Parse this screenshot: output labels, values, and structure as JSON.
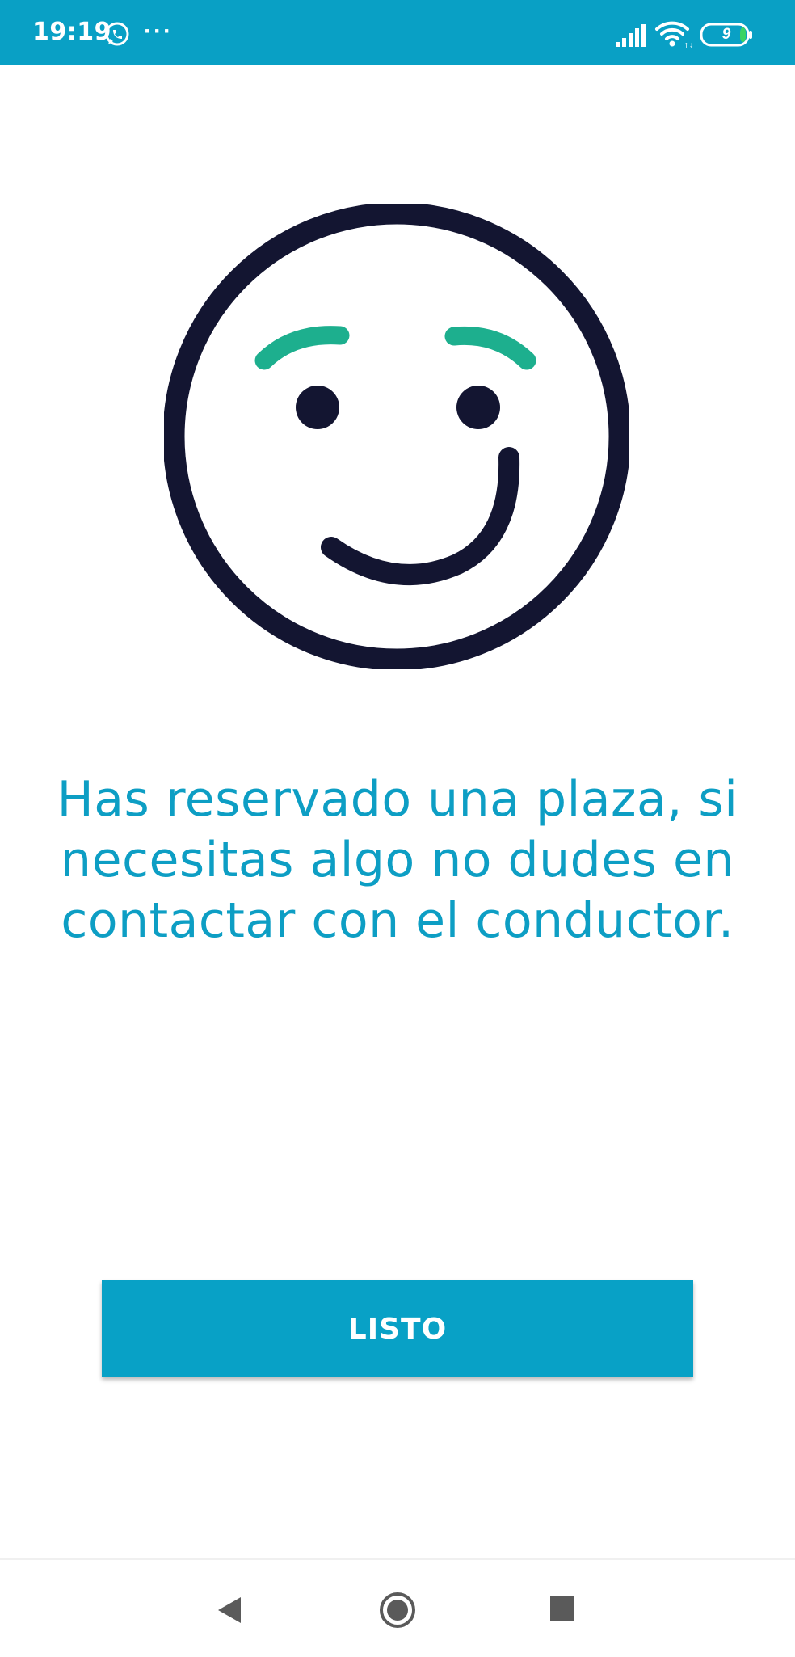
{
  "status_bar": {
    "time": "19:19",
    "battery_level": "9",
    "background_color": "#09a0c5",
    "icons": [
      "whatsapp-icon",
      "more-dots-icon",
      "signal-icon",
      "wifi-icon",
      "battery-icon"
    ]
  },
  "main": {
    "illustration": "smiley-face-icon",
    "message": "Has reservado una plaza, si necesitas algo no dudes en contactar con el conductor.",
    "done_button_label": "LISTO"
  },
  "nav_bar": {
    "icons": [
      "back-icon",
      "home-icon",
      "recents-icon"
    ]
  },
  "colors": {
    "accent": "#08a1c6",
    "text_accent": "#0d9ec4",
    "face_outline": "#131531",
    "eyebrows": "#1daf8e",
    "nav_icons": "#5a5a5a"
  }
}
